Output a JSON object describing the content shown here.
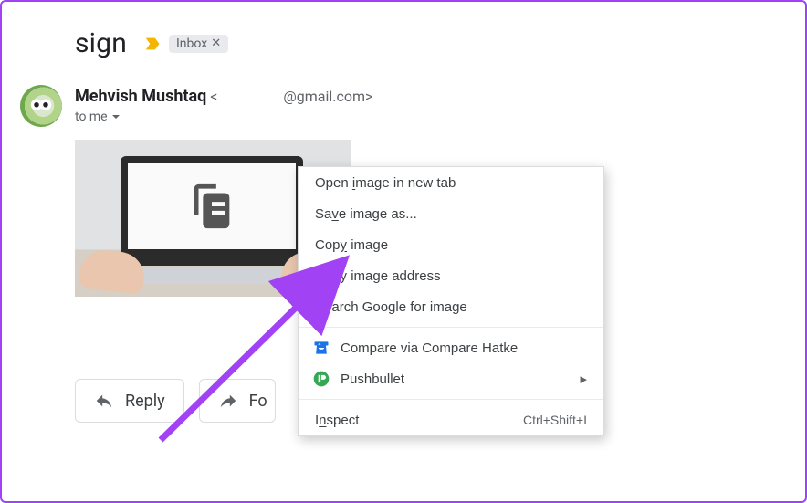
{
  "header": {
    "subject": "sign",
    "inbox_label": "Inbox"
  },
  "sender": {
    "name": "Mehvish Mushtaq",
    "email_prefix": "<",
    "email_domain": "@gmail.com>",
    "to_line": "to me"
  },
  "buttons": {
    "reply": "Reply",
    "forward": "Fo"
  },
  "context_menu": {
    "open_image": "Open image in new tab",
    "save_image": "Save image as...",
    "copy_image": "Copy image",
    "copy_address": "Copy image address",
    "search_google": "Search Google for image",
    "compare_hatke": "Compare via Compare Hatke",
    "pushbullet": "Pushbullet",
    "inspect": "Inspect",
    "inspect_shortcut": "Ctrl+Shift+I"
  },
  "icons": {
    "download": "download-icon",
    "compare_hatke": "compare-hatke-icon",
    "pushbullet": "pushbullet-icon"
  }
}
